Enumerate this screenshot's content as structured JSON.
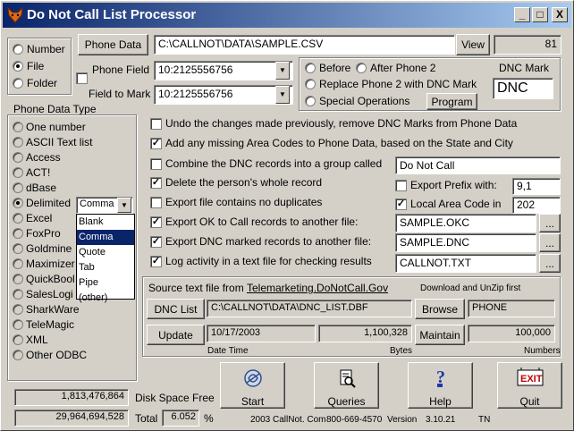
{
  "window": {
    "title": "Do Not Call List Processor",
    "min_label": "_",
    "max_label": "□",
    "close_label": "X"
  },
  "source": {
    "options": [
      "Number",
      "File",
      "Folder"
    ],
    "selected": "File"
  },
  "phone_data": {
    "button_label": "Phone Data",
    "path": "C:\\CALLNOT\\DATA\\SAMPLE.CSV",
    "view_label": "View",
    "count": "81"
  },
  "fields": {
    "phone_field_label": "Phone Field",
    "phone_field_value": "10:2125556756",
    "field_to_mark_label": "Field to Mark",
    "field_to_mark_value": "10:2125556756"
  },
  "mark_position": {
    "before_label": "Before",
    "after_label": "After Phone 2",
    "replace_label": "Replace Phone 2 with DNC Mark",
    "special_label": "Special Operations",
    "program_label": "Program",
    "dnc_mark_label": "DNC Mark",
    "dnc_mark_value": "DNC"
  },
  "phone_data_type": {
    "label": "Phone Data Type",
    "items": [
      "One number",
      "ASCII Text list",
      "Access",
      "ACT!",
      "dBase",
      "Delimited",
      "Excel",
      "FoxPro",
      "Goldmine",
      "Maximizer",
      "QuickBooks",
      "SalesLogix",
      "SharkWare",
      "TeleMagic",
      "XML",
      "Other ODBC"
    ],
    "visible_labels": [
      "One number",
      "ASCII Text list",
      "Access",
      "ACT!",
      "dBase",
      "Delimited",
      "Excel",
      "FoxPro",
      "Goldmine",
      "Maximizer",
      "QuickBool",
      "SalesLogi",
      "SharkWare",
      "TeleMagic",
      "XML",
      "Other ODBC"
    ],
    "selected": "Delimited",
    "delimiter_value": "Comma",
    "delimiter_options": [
      "Blank",
      "Comma",
      "Quote",
      "Tab",
      "Pipe",
      "(other)"
    ]
  },
  "options": {
    "undo": {
      "label": "Undo the changes made previously, remove DNC Marks from Phone Data",
      "checked": false
    },
    "add_area": {
      "label": "Add any missing Area Codes to Phone Data, based on the State and City",
      "checked": true
    },
    "combine": {
      "label": "Combine the DNC records into a group called",
      "checked": false,
      "value": "Do Not Call"
    },
    "delete": {
      "label": "Delete the person's whole record",
      "checked": true
    },
    "export_prefix": {
      "label": "Export  Prefix with:",
      "checked": false,
      "value": "9,1"
    },
    "no_dup": {
      "label": "Export file contains no duplicates",
      "checked": false
    },
    "local_area": {
      "label": "Local Area Code in",
      "checked": true,
      "value": "202"
    },
    "export_ok": {
      "label": "Export OK to Call records to another file:",
      "checked": true,
      "value": "SAMPLE.OKC"
    },
    "export_dnc": {
      "label": "Export DNC marked records to another file:",
      "checked": true,
      "value": "SAMPLE.DNC"
    },
    "log": {
      "label": "Log activity in a text file for checking results",
      "checked": true,
      "value": "CALLNOT.TXT"
    },
    "browse_dots": "..."
  },
  "dnc_source": {
    "label_prefix": "Source text file from",
    "link": "Telemarketing.DoNotCall.Gov",
    "download_note": "Download and UnZip first",
    "dnc_list_label": "DNC List",
    "dnc_list_path": "C:\\CALLNOT\\DATA\\DNC_LIST.DBF",
    "browse_label": "Browse",
    "field_value": "PHONE",
    "update_label": "Update",
    "date_value": "10/17/2003",
    "bytes_value": "1,100,328",
    "maintain_label": "Maintain",
    "numbers_value": "100,000",
    "date_caption": "Date Time",
    "bytes_caption": "Bytes",
    "numbers_caption": "Numbers"
  },
  "disk": {
    "free_value": "1,813,476,864",
    "free_label": "Disk Space Free",
    "total_value": "29,964,694,528",
    "total_label": "Total",
    "percent_value": "6.052",
    "percent_sign": "%"
  },
  "actions": {
    "start": "Start",
    "queries": "Queries",
    "help": "Help",
    "quit": "Quit",
    "exit_sign": "EXIT"
  },
  "footer": {
    "copyright": "2003  CallNot. Com",
    "phone": "800-669-4570",
    "version_label": "Version",
    "version": "3.10.21",
    "tn": "TN"
  },
  "colors": {
    "titlebar": "#0a246a",
    "face": "#d4d0c8",
    "selection": "#0a246a",
    "exit_red": "#c00000"
  }
}
